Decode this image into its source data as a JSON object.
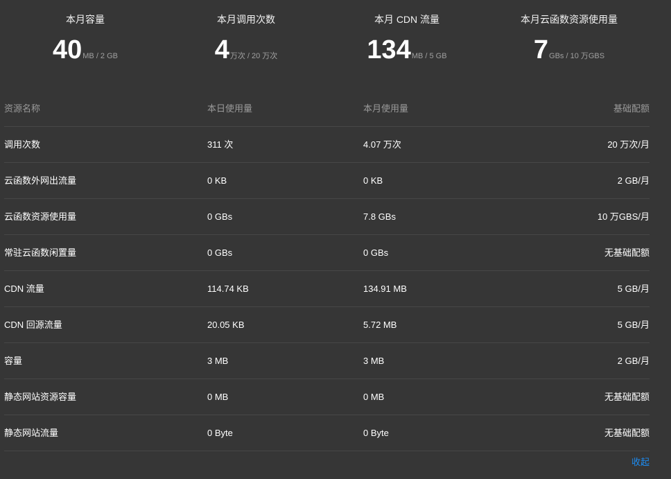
{
  "stats": [
    {
      "title": "本月容量",
      "value": "40",
      "unit": "MB / 2 GB"
    },
    {
      "title": "本月调用次数",
      "value": "4",
      "unit": "万次 / 20 万次"
    },
    {
      "title": "本月 CDN 流量",
      "value": "134",
      "unit": "MB / 5 GB"
    },
    {
      "title": "本月云函数资源使用量",
      "value": "7",
      "unit": "GBs / 10 万GBS"
    }
  ],
  "table": {
    "headers": {
      "name": "资源名称",
      "day": "本日使用量",
      "month": "本月使用量",
      "base": "基础配额"
    },
    "rows": [
      {
        "name": "调用次数",
        "day": "311 次",
        "month": "4.07 万次",
        "base": "20 万次/月"
      },
      {
        "name": "云函数外网出流量",
        "day": "0 KB",
        "month": "0 KB",
        "base": "2 GB/月"
      },
      {
        "name": "云函数资源使用量",
        "day": "0 GBs",
        "month": "7.8 GBs",
        "base": "10 万GBS/月"
      },
      {
        "name": "常驻云函数闲置量",
        "day": "0 GBs",
        "month": "0 GBs",
        "base": "无基础配额"
      },
      {
        "name": "CDN 流量",
        "day": "114.74 KB",
        "month": "134.91 MB",
        "base": "5 GB/月"
      },
      {
        "name": "CDN 回源流量",
        "day": "20.05 KB",
        "month": "5.72 MB",
        "base": "5 GB/月"
      },
      {
        "name": "容量",
        "day": "3 MB",
        "month": "3 MB",
        "base": "2 GB/月"
      },
      {
        "name": "静态网站资源容量",
        "day": "0 MB",
        "month": "0 MB",
        "base": "无基础配额"
      },
      {
        "name": "静态网站流量",
        "day": "0 Byte",
        "month": "0 Byte",
        "base": "无基础配额"
      }
    ]
  },
  "collapse_label": "收起",
  "colors": {
    "background": "#363636",
    "link": "#1c8cf2",
    "divider": "#474747"
  }
}
